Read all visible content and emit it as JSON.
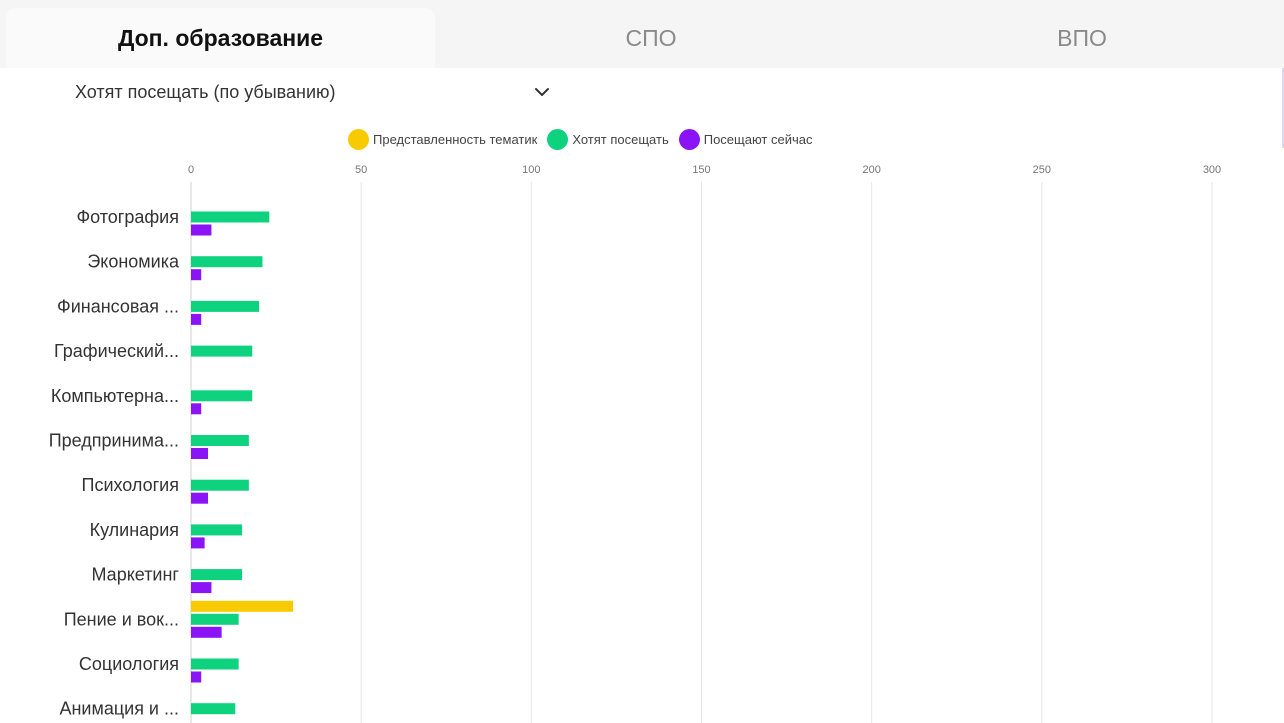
{
  "tabs": [
    {
      "label": "Доп. образование",
      "active": true
    },
    {
      "label": "СПО",
      "active": false
    },
    {
      "label": "ВПО",
      "active": false
    }
  ],
  "sort_select": {
    "value": "Хотят посещать (по убыванию)"
  },
  "colors": {
    "representation": "#f8cb00",
    "want": "#0fd27e",
    "attend": "#8a14f5",
    "grid": "#e6e6e6"
  },
  "chart_data": {
    "type": "bar",
    "orientation": "horizontal",
    "legend_position": "top",
    "grid": true,
    "xlim": [
      0,
      300
    ],
    "ticks": [
      0,
      50,
      100,
      150,
      200,
      250,
      300
    ],
    "categories": [
      "Фотография",
      "Экономика",
      "Финансовая ...",
      "Графический...",
      "Компьютерна...",
      "Предпринима...",
      "Психология",
      "Кулинария",
      "Маркетинг",
      "Пение и вок...",
      "Социология",
      "Анимация и ..."
    ],
    "series": [
      {
        "name": "Представленность тематик",
        "color": "#f8cb00",
        "values": [
          0,
          0,
          0,
          0,
          0,
          0,
          0,
          0,
          0,
          30,
          0,
          0
        ]
      },
      {
        "name": "Хотят посещать",
        "color": "#0fd27e",
        "values": [
          23,
          21,
          20,
          18,
          18,
          17,
          17,
          15,
          15,
          14,
          14,
          13
        ]
      },
      {
        "name": "Посещают сейчас",
        "color": "#8a14f5",
        "values": [
          6,
          3,
          3,
          0,
          3,
          5,
          5,
          4,
          6,
          9,
          3,
          0
        ]
      }
    ]
  }
}
